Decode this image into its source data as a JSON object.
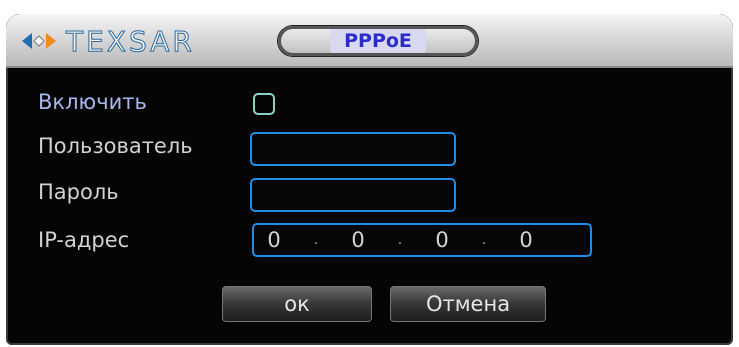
{
  "titlebar": {
    "logo_text": "TEXSAR",
    "tab_label": "PPPoE"
  },
  "form": {
    "enable_label": "Включить",
    "enable_checked": false,
    "user_label": "Пользователь",
    "user_value": "",
    "password_label": "Пароль",
    "password_value": "",
    "ip_label": "IP-адрес",
    "ip": {
      "o1": "0",
      "o2": "0",
      "o3": "0",
      "o4": "0",
      "sep": "."
    }
  },
  "buttons": {
    "ok_label": "ок",
    "cancel_label": "Отмена"
  },
  "colors": {
    "field_border": "#1e8ee8",
    "tab_text": "#2c2ccc",
    "enable_label": "#a9b7ee",
    "checkbox_border": "#8ad2c8"
  },
  "icons": [
    "diamond-arrows-logo-icon"
  ]
}
